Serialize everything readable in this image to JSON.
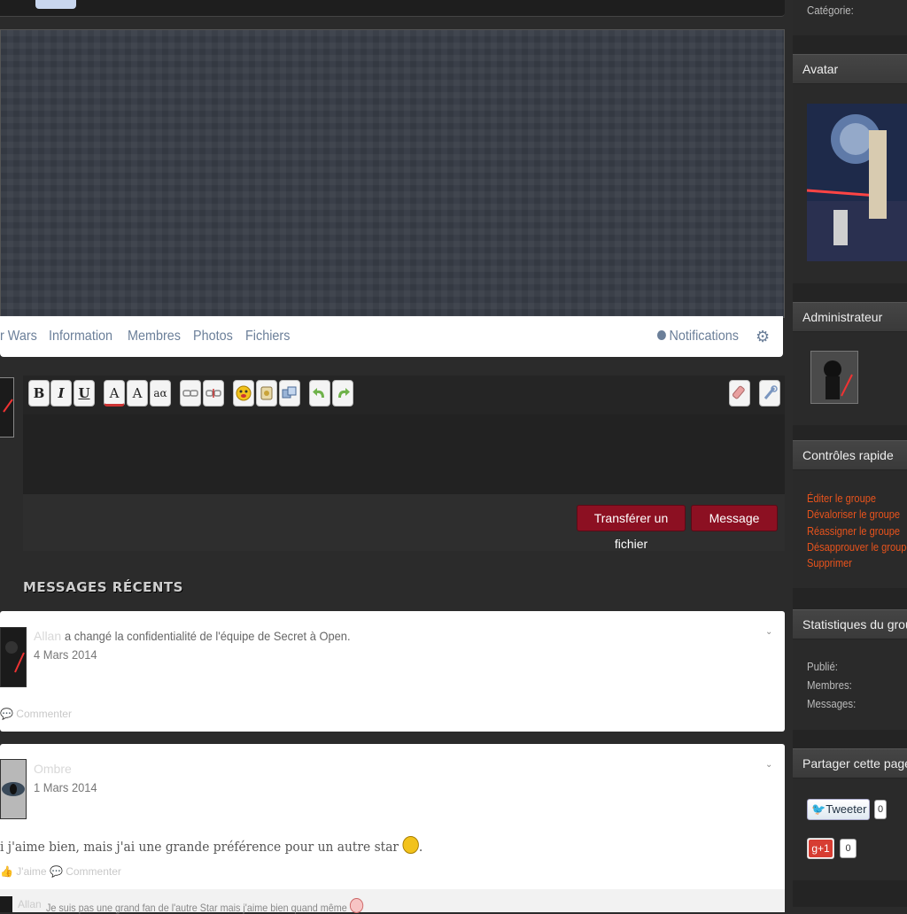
{
  "nav": {
    "group_title_partial": "r Wars",
    "links": [
      "Information",
      "Membres",
      "Photos",
      "Fichiers"
    ],
    "notifications": "Notifications"
  },
  "editor": {
    "toolbar": [
      "B",
      "I",
      "U",
      "A",
      "A",
      "aα"
    ],
    "upload_button": "Transférer un fichier",
    "message_button": "Message"
  },
  "recent": {
    "title": "MESSAGES RÉCENTS",
    "items": [
      {
        "user": "Allan",
        "text": "a changé la confidentialité de l'équipe de Secret à Open.",
        "date": "4 Mars 2014",
        "actions": "Commenter"
      },
      {
        "user": "Ombre",
        "date": "1 Mars 2014",
        "body": "i j'aime bien, mais j'ai une grande préférence pour un autre star",
        "body_end": ".",
        "like": "J'aime",
        "comment": "Commenter",
        "reply_user": "Allan",
        "reply_text": "Je suis pas une grand fan de l'autre Star mais j'aime bien quand même"
      }
    ]
  },
  "sidebar": {
    "categorie": "Catégorie:",
    "avatar_title": "Avatar",
    "admin_title": "Administrateur",
    "controls_title": "Contrôles rapide",
    "controls": [
      "Éditer le groupe",
      "Dévaloriser le groupe",
      "Réassigner le groupe",
      "Désapprouver le groupe",
      "Supprimer"
    ],
    "stats_title": "Statistiques du groupe",
    "stats": [
      "Publié:",
      "Membres:",
      "Messages:"
    ],
    "share_title": "Partager cette page",
    "tweet_label": "Tweeter",
    "tweet_count": "0",
    "gplus_label": "+1",
    "gplus_count": "0"
  },
  "colors": {
    "accent_red": "#8c1022",
    "link_orange": "#e8531c",
    "nav_blue": "#6b7f99"
  }
}
